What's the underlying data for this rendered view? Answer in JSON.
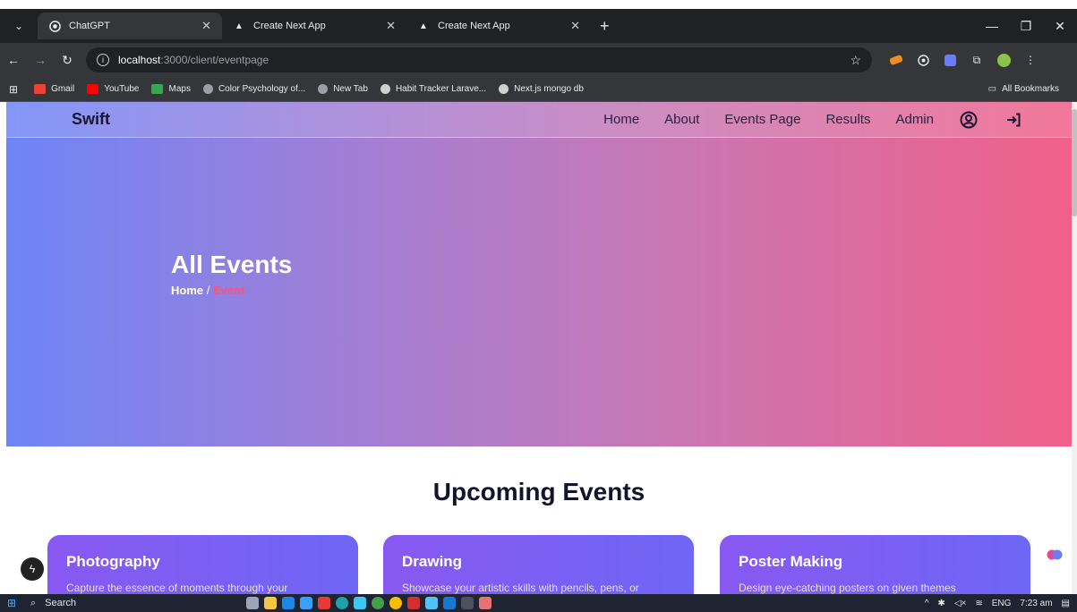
{
  "browser": {
    "tabs": [
      {
        "title": "ChatGPT",
        "active": true,
        "icon": "openai-icon"
      },
      {
        "title": "Create Next App",
        "active": false,
        "icon": "triangle-icon"
      },
      {
        "title": "Create Next App",
        "active": false,
        "icon": "triangle-icon"
      }
    ],
    "url_host": "localhost",
    "url_path": ":3000/client/eventpage",
    "bookmarks": [
      {
        "label": "Gmail",
        "color": "#ea4335"
      },
      {
        "label": "YouTube",
        "color": "#ff0000"
      },
      {
        "label": "Maps",
        "color": "#34a853"
      },
      {
        "label": "Color Psychology of...",
        "color": "#9aa0a6"
      },
      {
        "label": "New Tab",
        "color": "#9aa0a6"
      },
      {
        "label": "Habit Tracker Larave...",
        "color": "#9aa0a6"
      },
      {
        "label": "Next.js mongo db",
        "color": "#9aa0a6"
      }
    ],
    "all_bookmarks": "All Bookmarks"
  },
  "site": {
    "brand": "Swift",
    "nav": [
      "Home",
      "About",
      "Events Page",
      "Results",
      "Admin"
    ],
    "hero_title": "All Events",
    "breadcrumb_home": "Home",
    "breadcrumb_sep": "/",
    "breadcrumb_current": "Event",
    "section_title": "Upcoming Events",
    "cards": [
      {
        "name": "Photography",
        "desc": "Capture the essence of moments through your"
      },
      {
        "name": "Drawing",
        "desc": "Showcase your artistic skills with pencils, pens, or"
      },
      {
        "name": "Poster Making",
        "desc": "Design eye-catching posters on given themes"
      }
    ],
    "colors": {
      "accent": "#ff5078",
      "card": "#7b5ff4"
    }
  },
  "taskbar": {
    "search": "Search",
    "lang": "ENG",
    "time": "7:23 am"
  }
}
